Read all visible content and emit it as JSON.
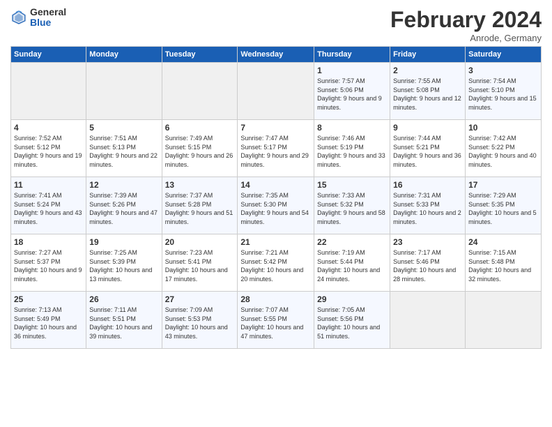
{
  "logo": {
    "general": "General",
    "blue": "Blue"
  },
  "header": {
    "month": "February 2024",
    "location": "Anrode, Germany"
  },
  "weekdays": [
    "Sunday",
    "Monday",
    "Tuesday",
    "Wednesday",
    "Thursday",
    "Friday",
    "Saturday"
  ],
  "weeks": [
    [
      {
        "day": "",
        "sunrise": "",
        "sunset": "",
        "daylight": ""
      },
      {
        "day": "",
        "sunrise": "",
        "sunset": "",
        "daylight": ""
      },
      {
        "day": "",
        "sunrise": "",
        "sunset": "",
        "daylight": ""
      },
      {
        "day": "",
        "sunrise": "",
        "sunset": "",
        "daylight": ""
      },
      {
        "day": "1",
        "sunrise": "Sunrise: 7:57 AM",
        "sunset": "Sunset: 5:06 PM",
        "daylight": "Daylight: 9 hours and 9 minutes."
      },
      {
        "day": "2",
        "sunrise": "Sunrise: 7:55 AM",
        "sunset": "Sunset: 5:08 PM",
        "daylight": "Daylight: 9 hours and 12 minutes."
      },
      {
        "day": "3",
        "sunrise": "Sunrise: 7:54 AM",
        "sunset": "Sunset: 5:10 PM",
        "daylight": "Daylight: 9 hours and 15 minutes."
      }
    ],
    [
      {
        "day": "4",
        "sunrise": "Sunrise: 7:52 AM",
        "sunset": "Sunset: 5:12 PM",
        "daylight": "Daylight: 9 hours and 19 minutes."
      },
      {
        "day": "5",
        "sunrise": "Sunrise: 7:51 AM",
        "sunset": "Sunset: 5:13 PM",
        "daylight": "Daylight: 9 hours and 22 minutes."
      },
      {
        "day": "6",
        "sunrise": "Sunrise: 7:49 AM",
        "sunset": "Sunset: 5:15 PM",
        "daylight": "Daylight: 9 hours and 26 minutes."
      },
      {
        "day": "7",
        "sunrise": "Sunrise: 7:47 AM",
        "sunset": "Sunset: 5:17 PM",
        "daylight": "Daylight: 9 hours and 29 minutes."
      },
      {
        "day": "8",
        "sunrise": "Sunrise: 7:46 AM",
        "sunset": "Sunset: 5:19 PM",
        "daylight": "Daylight: 9 hours and 33 minutes."
      },
      {
        "day": "9",
        "sunrise": "Sunrise: 7:44 AM",
        "sunset": "Sunset: 5:21 PM",
        "daylight": "Daylight: 9 hours and 36 minutes."
      },
      {
        "day": "10",
        "sunrise": "Sunrise: 7:42 AM",
        "sunset": "Sunset: 5:22 PM",
        "daylight": "Daylight: 9 hours and 40 minutes."
      }
    ],
    [
      {
        "day": "11",
        "sunrise": "Sunrise: 7:41 AM",
        "sunset": "Sunset: 5:24 PM",
        "daylight": "Daylight: 9 hours and 43 minutes."
      },
      {
        "day": "12",
        "sunrise": "Sunrise: 7:39 AM",
        "sunset": "Sunset: 5:26 PM",
        "daylight": "Daylight: 9 hours and 47 minutes."
      },
      {
        "day": "13",
        "sunrise": "Sunrise: 7:37 AM",
        "sunset": "Sunset: 5:28 PM",
        "daylight": "Daylight: 9 hours and 51 minutes."
      },
      {
        "day": "14",
        "sunrise": "Sunrise: 7:35 AM",
        "sunset": "Sunset: 5:30 PM",
        "daylight": "Daylight: 9 hours and 54 minutes."
      },
      {
        "day": "15",
        "sunrise": "Sunrise: 7:33 AM",
        "sunset": "Sunset: 5:32 PM",
        "daylight": "Daylight: 9 hours and 58 minutes."
      },
      {
        "day": "16",
        "sunrise": "Sunrise: 7:31 AM",
        "sunset": "Sunset: 5:33 PM",
        "daylight": "Daylight: 10 hours and 2 minutes."
      },
      {
        "day": "17",
        "sunrise": "Sunrise: 7:29 AM",
        "sunset": "Sunset: 5:35 PM",
        "daylight": "Daylight: 10 hours and 5 minutes."
      }
    ],
    [
      {
        "day": "18",
        "sunrise": "Sunrise: 7:27 AM",
        "sunset": "Sunset: 5:37 PM",
        "daylight": "Daylight: 10 hours and 9 minutes."
      },
      {
        "day": "19",
        "sunrise": "Sunrise: 7:25 AM",
        "sunset": "Sunset: 5:39 PM",
        "daylight": "Daylight: 10 hours and 13 minutes."
      },
      {
        "day": "20",
        "sunrise": "Sunrise: 7:23 AM",
        "sunset": "Sunset: 5:41 PM",
        "daylight": "Daylight: 10 hours and 17 minutes."
      },
      {
        "day": "21",
        "sunrise": "Sunrise: 7:21 AM",
        "sunset": "Sunset: 5:42 PM",
        "daylight": "Daylight: 10 hours and 20 minutes."
      },
      {
        "day": "22",
        "sunrise": "Sunrise: 7:19 AM",
        "sunset": "Sunset: 5:44 PM",
        "daylight": "Daylight: 10 hours and 24 minutes."
      },
      {
        "day": "23",
        "sunrise": "Sunrise: 7:17 AM",
        "sunset": "Sunset: 5:46 PM",
        "daylight": "Daylight: 10 hours and 28 minutes."
      },
      {
        "day": "24",
        "sunrise": "Sunrise: 7:15 AM",
        "sunset": "Sunset: 5:48 PM",
        "daylight": "Daylight: 10 hours and 32 minutes."
      }
    ],
    [
      {
        "day": "25",
        "sunrise": "Sunrise: 7:13 AM",
        "sunset": "Sunset: 5:49 PM",
        "daylight": "Daylight: 10 hours and 36 minutes."
      },
      {
        "day": "26",
        "sunrise": "Sunrise: 7:11 AM",
        "sunset": "Sunset: 5:51 PM",
        "daylight": "Daylight: 10 hours and 39 minutes."
      },
      {
        "day": "27",
        "sunrise": "Sunrise: 7:09 AM",
        "sunset": "Sunset: 5:53 PM",
        "daylight": "Daylight: 10 hours and 43 minutes."
      },
      {
        "day": "28",
        "sunrise": "Sunrise: 7:07 AM",
        "sunset": "Sunset: 5:55 PM",
        "daylight": "Daylight: 10 hours and 47 minutes."
      },
      {
        "day": "29",
        "sunrise": "Sunrise: 7:05 AM",
        "sunset": "Sunset: 5:56 PM",
        "daylight": "Daylight: 10 hours and 51 minutes."
      },
      {
        "day": "",
        "sunrise": "",
        "sunset": "",
        "daylight": ""
      },
      {
        "day": "",
        "sunrise": "",
        "sunset": "",
        "daylight": ""
      }
    ]
  ]
}
